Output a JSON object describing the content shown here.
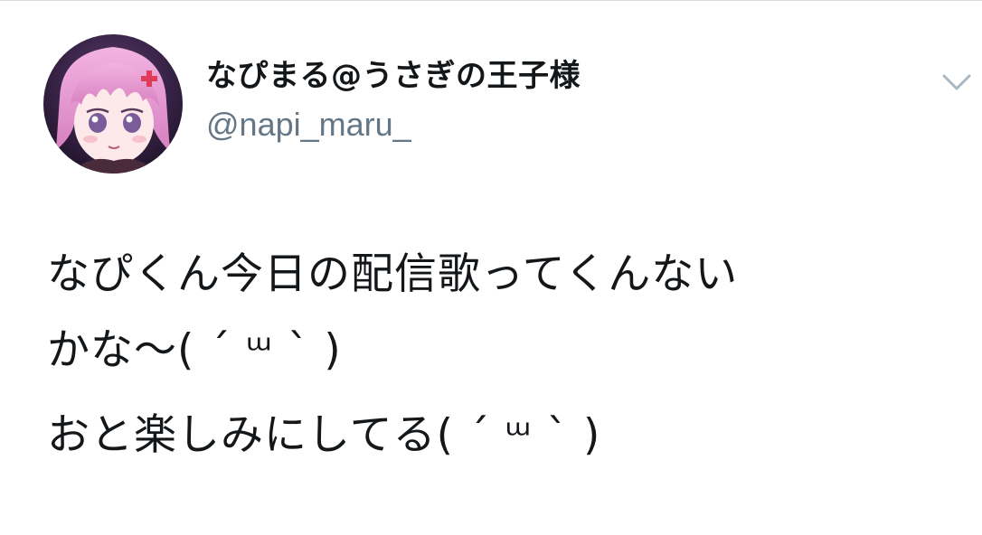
{
  "user": {
    "display_name": "なぴまる@うさぎの王子様",
    "handle": "@napi_maru_"
  },
  "menu": {
    "icon": "chevron-down-icon"
  },
  "tweet": {
    "lines": [
      "なぴくん今日の配信歌ってくんない",
      "かな〜( ´ ᵚ ` )"
    ],
    "second_paragraph": "おと楽しみにしてる( ´ ᵚ ` )"
  },
  "colors": {
    "text": "#14171a",
    "secondary": "#657786",
    "caret": "#aab8c2",
    "avatar_hair": "#e79bd1",
    "avatar_bg": "#2a1a3a"
  }
}
